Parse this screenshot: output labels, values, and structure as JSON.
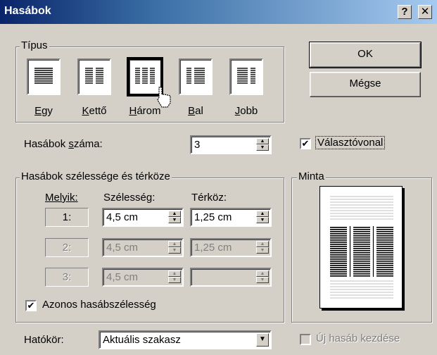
{
  "window": {
    "title": "Hasábok",
    "help_btn": "?",
    "close_btn": "✕"
  },
  "presets": {
    "legend": "Típus",
    "items": [
      {
        "label": "Egy",
        "key": "E",
        "rest": "gy"
      },
      {
        "label": "Kettő",
        "key": "K",
        "rest": "ettő"
      },
      {
        "label": "Három",
        "key": "H",
        "rest": "árom"
      },
      {
        "label": "Bal",
        "key": "B",
        "rest": "al"
      },
      {
        "label": "Jobb",
        "key": "J",
        "rest": "obb"
      }
    ],
    "selected": "Három"
  },
  "buttons": {
    "ok": "OK",
    "cancel": "Mégse"
  },
  "columns_count": {
    "label_pre": "Hasábok ",
    "label_key": "s",
    "label_post": "záma:",
    "value": "3"
  },
  "separator": {
    "label": "Választóvonal",
    "checked": true
  },
  "width_spacing": {
    "legend": "Hasábok szélessége és térköze",
    "headers": {
      "which": "Melyik:",
      "width": "Szélesség:",
      "spacing": "Térköz:"
    },
    "rows": [
      {
        "index": "1:",
        "width": "4,5 cm",
        "spacing": "1,25 cm",
        "enabled": true
      },
      {
        "index": "2:",
        "width": "4,5 cm",
        "spacing": "1,25 cm",
        "enabled": false
      },
      {
        "index": "3:",
        "width": "4,5 cm",
        "spacing": "",
        "enabled": false
      }
    ],
    "equal_width": {
      "label": "Azonos hasábszélesség",
      "checked": true
    }
  },
  "preview": {
    "legend": "Minta"
  },
  "apply_to": {
    "label": "Hatókör:",
    "value": "Aktuális szakasz"
  },
  "new_column": {
    "label": "Új hasáb kezdése",
    "checked": false
  }
}
